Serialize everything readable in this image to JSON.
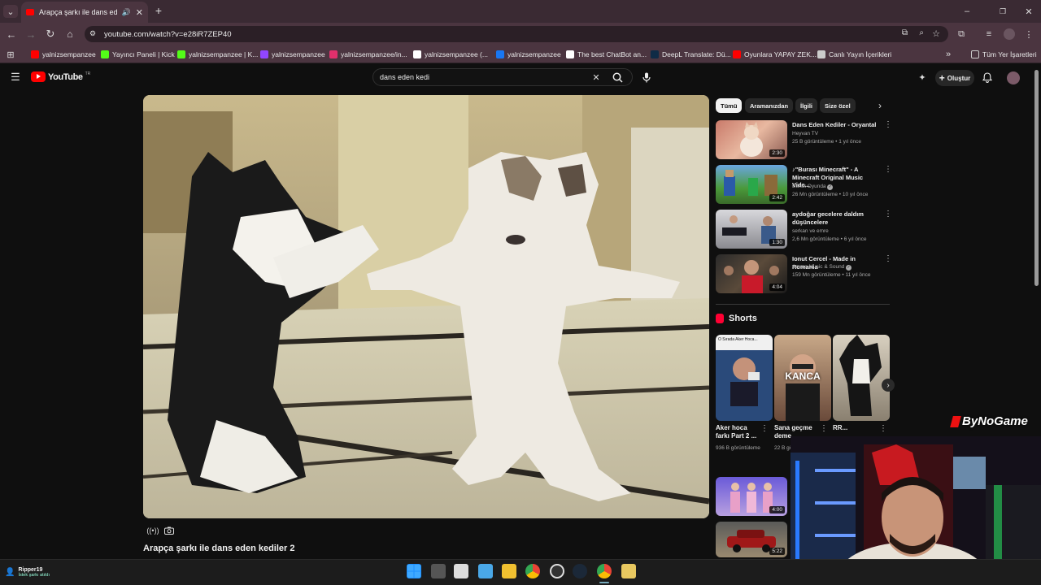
{
  "browser": {
    "tab_title": "Arapça şarkı ile dans eden kediler 2",
    "url": "youtube.com/watch?v=e28iR7ZEP40",
    "bookmarks": [
      {
        "label": "yalnizsempanzee",
        "icon": "youtube-icon",
        "color": "#ff0000"
      },
      {
        "label": "Yayıncı Paneli | Kick",
        "icon": "kick-icon",
        "color": "#53fc18"
      },
      {
        "label": "yalnizsempanzee | K...",
        "icon": "kick-icon",
        "color": "#53fc18"
      },
      {
        "label": "yalnizsempanzee",
        "icon": "twitch-icon",
        "color": "#9146ff"
      },
      {
        "label": "yalnizsempanzee/in...",
        "icon": "instagram-icon",
        "color": "#e1306c"
      },
      {
        "label": "yalnizsempanzee (...",
        "icon": "tiktok-icon",
        "color": "#ffffff"
      },
      {
        "label": "yalnizsempanzee",
        "icon": "facebook-icon",
        "color": "#1877f2"
      },
      {
        "label": "The best ChatBot an...",
        "icon": "chatbot-icon",
        "color": "#ffffff"
      },
      {
        "label": "DeepL Translate: Dü...",
        "icon": "deepl-icon",
        "color": "#0f2b46"
      },
      {
        "label": "Oyunlara YAPAY ZEK...",
        "icon": "youtube-icon",
        "color": "#ff0000"
      },
      {
        "label": "Canlı Yayın İçerikleri",
        "icon": "folder-icon",
        "color": "#cccccc"
      }
    ],
    "all_bookmarks": "Tüm Yer İşaretleri"
  },
  "youtube": {
    "logo": "YouTube",
    "logo_region": "TR",
    "search_value": "dans eden kedi",
    "create_label": "Oluştur",
    "video_title": "Arapça şarkı ile dans eden kediler 2",
    "chips": [
      "Tümü",
      "Aramanızdan",
      "İlgili",
      "Size özel"
    ],
    "related": [
      {
        "title": "Dans Eden Kediler - Oryantal",
        "channel": "Heyvan TV",
        "meta": "25 B görüntüleme • 1 yıl önce",
        "duration": "2:30",
        "verified": false
      },
      {
        "title": "♪\"Burası Minecraft\" - A Minecraft Original Music Vide...",
        "channel": "Burak Oyunda",
        "meta": "26 Mn görüntüleme • 10 yıl önce",
        "duration": "2:42",
        "verified": true
      },
      {
        "title": "aydoğar gecelere daldım düşüncelere",
        "channel": "serkan ve emre",
        "meta": "2,6 Mn görüntüleme • 6 yıl önce",
        "duration": "1:30",
        "verified": false
      },
      {
        "title": "Ionut Cercel - Made in Romania",
        "channel": "Amma Music & Sound",
        "meta": "159 Mn görüntüleme • 11 yıl önce",
        "duration": "4:04",
        "verified": true
      }
    ],
    "shorts_header": "Shorts",
    "shorts": [
      {
        "title": "Aker hoca farkı Part 2 ...",
        "views": "936 B görüntüleme",
        "overlay": "O Sırada Aker Hoca..."
      },
      {
        "title": "Sana geçme deme...",
        "views": "22 B görüntüleme",
        "overlay": "KANCA"
      },
      {
        "title": "RR...",
        "views": "",
        "overlay": ""
      }
    ],
    "more_durations": [
      "4:00",
      "5:22"
    ]
  },
  "overlay": {
    "watermark": "ByNoGame",
    "notify_user": "Ripper19",
    "notify_text": "İstek şarkı atıldı"
  }
}
